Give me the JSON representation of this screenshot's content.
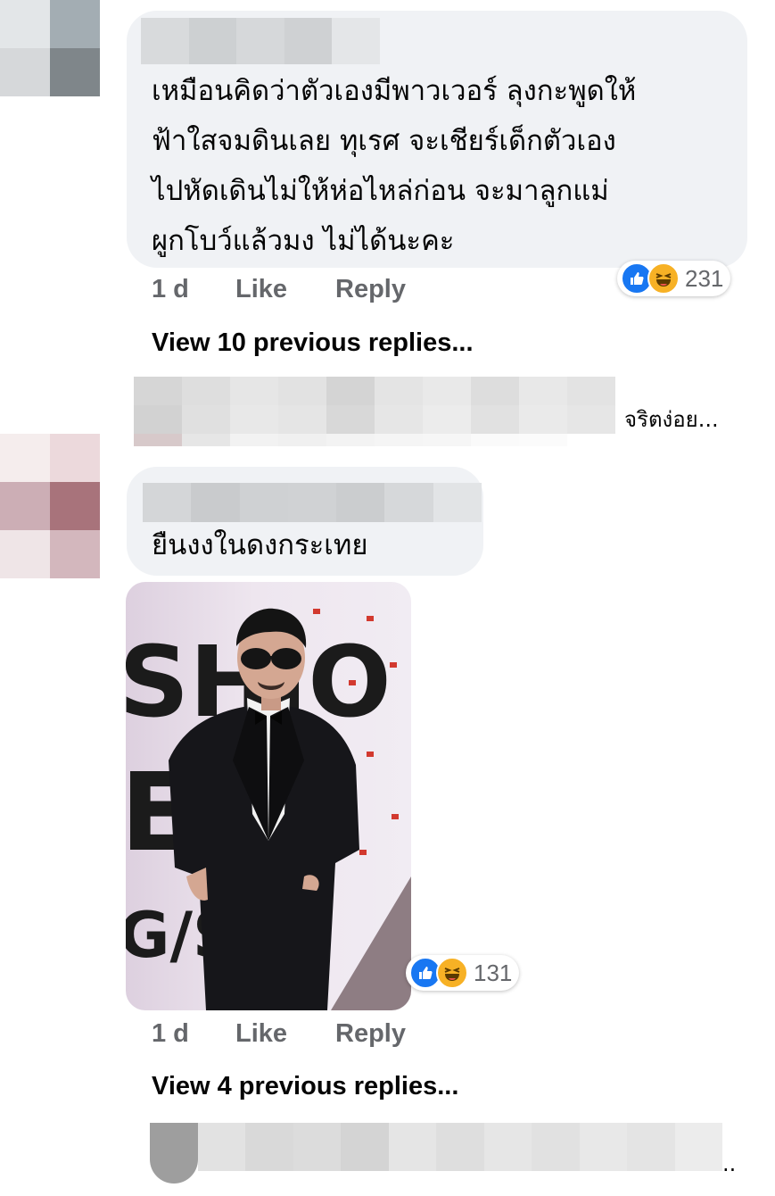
{
  "comments": [
    {
      "text_lines": [
        "เหมือนคิดว่าตัวเองมีพาวเวอร์ ลุงกะพูดให้",
        "ฟ้าใสจมดินเลย ทุเรศ จะเชียร์เด็กตัวเอง",
        "ไปหัดเดินไม่ให้ห่อไหล่ก่อน จะมาลูกแม่",
        "ผูกโบว์แล้วมง ไม่ได้นะคะ"
      ],
      "time": "1 d",
      "like_label": "Like",
      "reply_label": "Reply",
      "reaction_count": "231",
      "reaction_icons": [
        "like-icon",
        "haha-icon"
      ],
      "view_replies": "View 10 previous replies..."
    },
    {
      "text": "ยืนงงในดงกระเทย",
      "time": "1 d",
      "like_label": "Like",
      "reply_label": "Reply",
      "reaction_count": "131",
      "reaction_icons": [
        "like-icon",
        "haha-icon"
      ],
      "view_replies": "View 4 previous replies..."
    }
  ],
  "reply_preview_1": {
    "text": "จริตง่อย..."
  },
  "reply_preview_2": {
    "text": ".."
  },
  "photo": {
    "backdrop_letters": [
      "SHIO",
      "EK",
      "G/SU"
    ]
  },
  "colors": {
    "bubble": "#f0f2f5",
    "meta": "#65676b",
    "like_blue": "#1877f2",
    "haha_yellow": "#f7b125"
  }
}
